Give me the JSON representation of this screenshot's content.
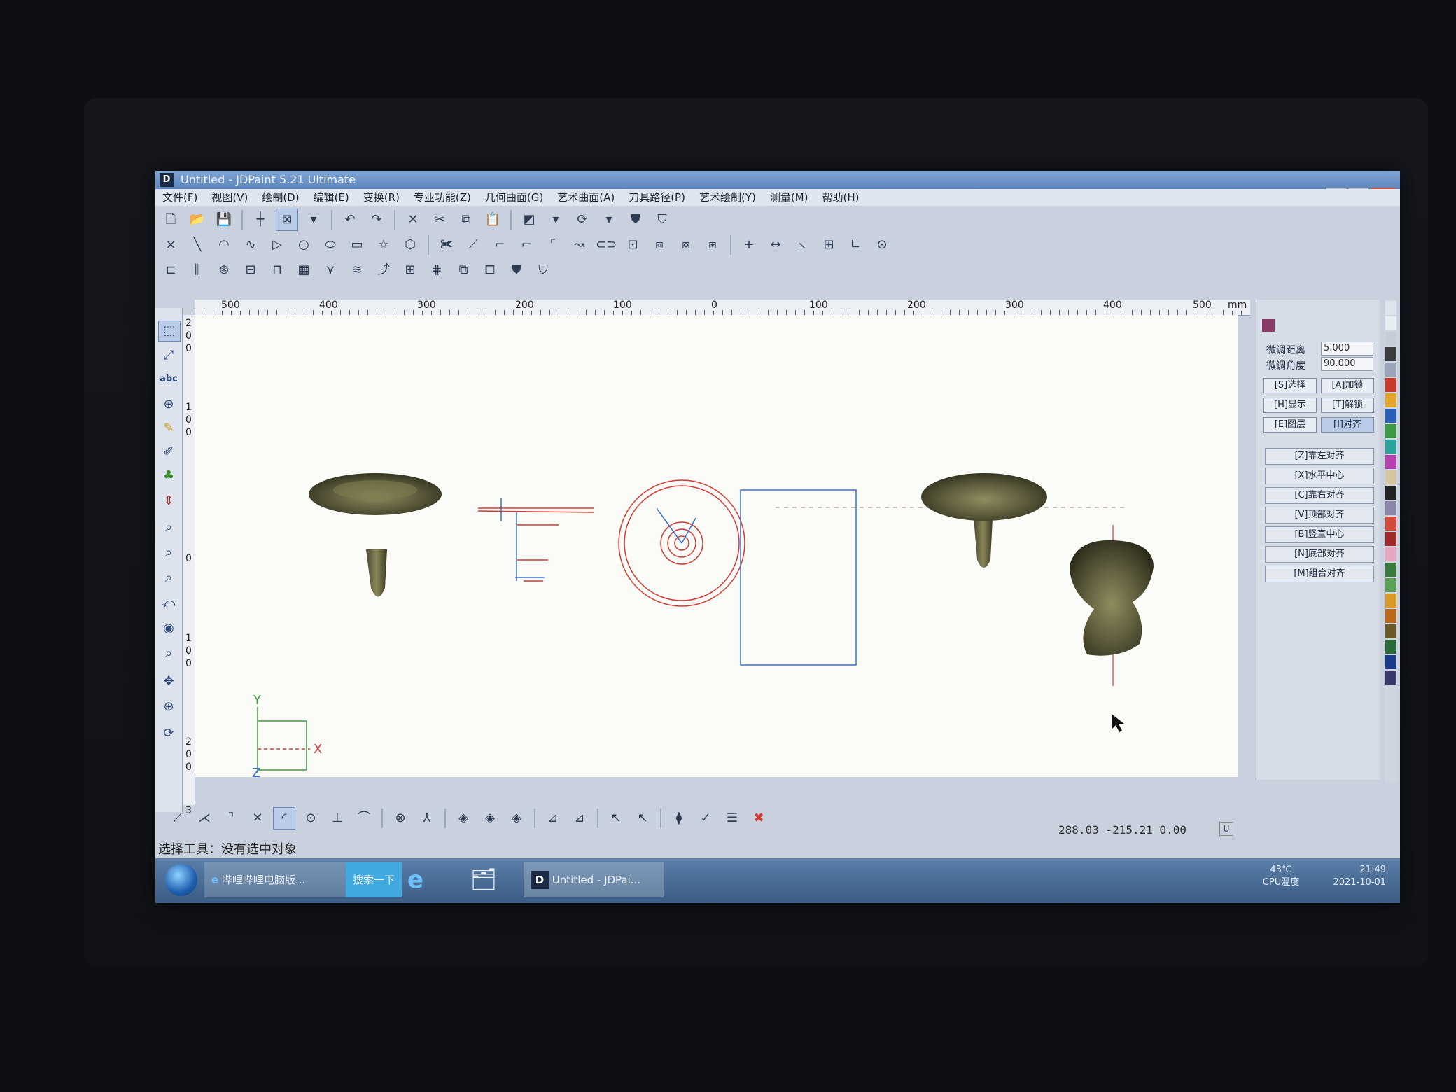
{
  "window": {
    "title": "Untitled - JDPaint 5.21 Ultimate",
    "logo": "D"
  },
  "menu": [
    "文件(F)",
    "视图(V)",
    "绘制(D)",
    "编辑(E)",
    "变换(R)",
    "专业功能(Z)",
    "几何曲面(G)",
    "艺术曲面(A)",
    "刀具路径(P)",
    "艺术绘制(Y)",
    "测量(M)",
    "帮助(H)"
  ],
  "ruler": {
    "h_labels": [
      "500",
      "400",
      "300",
      "200",
      "100",
      "0",
      "100",
      "200",
      "300",
      "400",
      "500"
    ],
    "unit": "mm"
  },
  "right_panel": {
    "fine_distance_label": "微调距离",
    "fine_distance_value": "5.000",
    "fine_angle_label": "微调角度",
    "fine_angle_value": "90.000",
    "buttons": [
      "[S]选择",
      "[A]加锁",
      "[H]显示",
      "[T]解锁",
      "[E]图层",
      "[I]对齐"
    ],
    "align_buttons": [
      "[Z]靠左对齐",
      "[X]水平中心",
      "[C]靠右对齐",
      "[V]顶部对齐",
      "[B]竖直中心",
      "[N]底部对齐",
      "[M]组合对齐"
    ]
  },
  "axis": {
    "y": "Y",
    "x": "X",
    "z": "Z"
  },
  "status": {
    "coords": "288.03 -215.21 0.00",
    "u_button": "U",
    "message": "选择工具：没有选中对象"
  },
  "taskbar": {
    "ie_item": "哔哩哔哩电脑版...",
    "search_item": "搜索一下",
    "jdpaint_item": "Untitled - JDPai...",
    "cpu_temp": "43℃",
    "cpu_label": "CPU温度",
    "time": "21:49",
    "date": "2021-10-01"
  },
  "colors": {
    "model_fill": "#5d5b3c",
    "red_lines": "#d23a32",
    "blue_lines": "#3b6fd6"
  }
}
